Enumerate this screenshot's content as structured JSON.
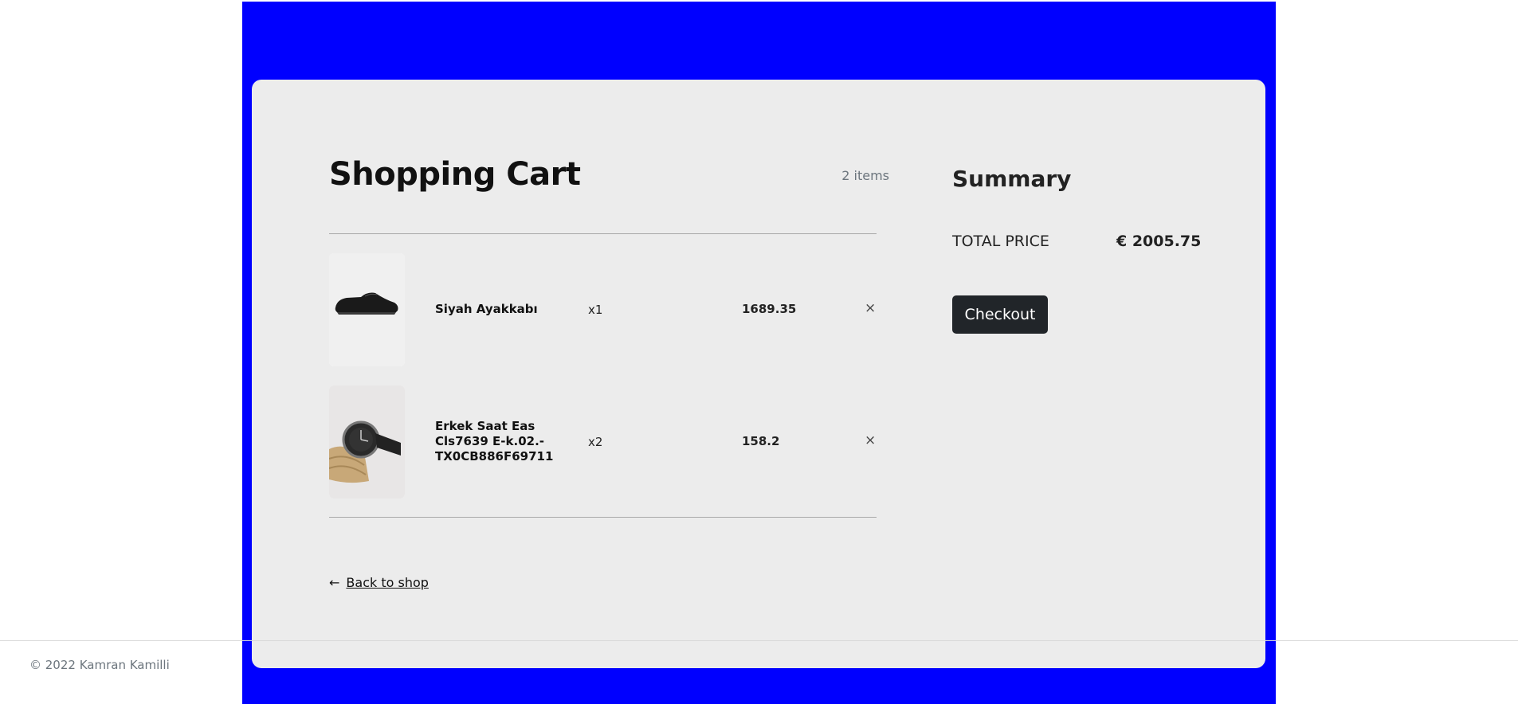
{
  "cart": {
    "title": "Shopping Cart",
    "item_count": "2 items",
    "items": [
      {
        "name": "Siyah Ayakkabı",
        "quantity": "x1",
        "price": "1689.35",
        "remove": "×",
        "image": "black-shoe"
      },
      {
        "name": "Erkek Saat Eas Cls7639 E-k.02.-TX0CB886F69711",
        "quantity": "x2",
        "price": "158.2",
        "remove": "×",
        "image": "wristwatch"
      }
    ],
    "back_label": "Back to shop",
    "back_icon": "←"
  },
  "summary": {
    "title": "Summary",
    "total_label": "TOTAL PRICE",
    "total_value": "€ 2005.75",
    "checkout_label": "Checkout"
  },
  "footer": {
    "text": "© 2022 Kamran Kamilli"
  },
  "colors": {
    "band": "#0000ff",
    "card": "#ececec",
    "button": "#212529"
  }
}
